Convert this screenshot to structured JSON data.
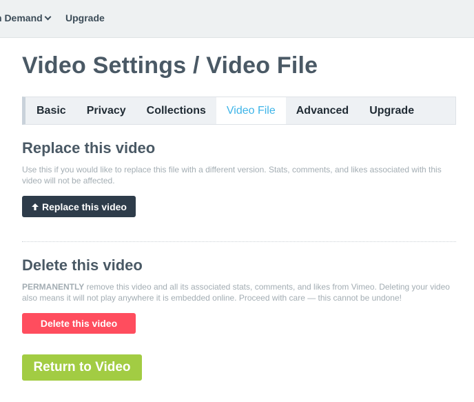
{
  "topnav": {
    "items": [
      {
        "label": "n Demand"
      },
      {
        "label": "Upgrade"
      }
    ]
  },
  "page": {
    "title": "Video Settings / Video File"
  },
  "tabs": [
    {
      "label": "Basic"
    },
    {
      "label": "Privacy"
    },
    {
      "label": "Collections"
    },
    {
      "label": "Video File",
      "active": true
    },
    {
      "label": "Advanced"
    },
    {
      "label": "Upgrade"
    }
  ],
  "replace": {
    "title": "Replace this video",
    "description": "Use this if you would like to replace this file with a different version. Stats, comments, and likes associated with this video will not be affected.",
    "button_label": "Replace this video",
    "button_icon": "arrow-up-icon"
  },
  "delete": {
    "title": "Delete this video",
    "description_emphasis": "PERMANENTLY",
    "description_rest": " remove this video and all its associated stats, comments, and likes from Vimeo. Deleting your video also means it will not play anywhere it is embedded online. Proceed with care — this cannot be undone!",
    "button_label": "Delete this video"
  },
  "return_button": {
    "label": "Return to Video"
  },
  "colors": {
    "accent": "#3db4e8",
    "dark_button": "#2e3c4a",
    "danger": "#ff4d5e",
    "success": "#a2cc43"
  }
}
